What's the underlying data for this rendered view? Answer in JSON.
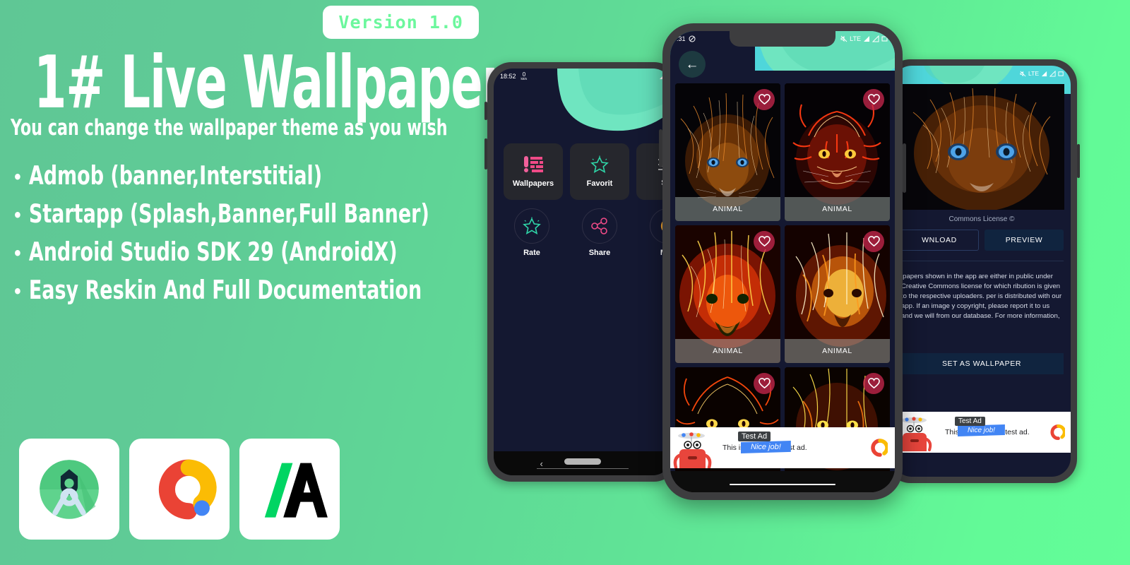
{
  "promo": {
    "title": "1# Live Wallpaper",
    "subtitle": "You can change the wallpaper theme as you wish",
    "bullet_char": "•",
    "features": [
      "Admob (banner,Interstitial)",
      "Startapp (Splash,Banner,Full Banner)",
      "Android Studio SDK 29 (AndroidX)",
      "Easy Reskin And Full Documentation"
    ],
    "version_badge": "Version 1.0",
    "tech_icons": [
      {
        "name": "android-studio-icon",
        "label": "Android Studio"
      },
      {
        "name": "admob-icon",
        "label": "AdMob"
      },
      {
        "name": "startapp-icon",
        "label": "StartApp"
      }
    ]
  },
  "colors": {
    "background_left": "#5fc795",
    "background_right": "#63fd98",
    "badge_text": "#6cf79d",
    "app_dark": "#141831",
    "accent_teal": "#6fe5c0",
    "favorite_pink": "#c4264c",
    "phone_frame": "#3d3d3f"
  },
  "phone_left": {
    "status": {
      "time": "18:52",
      "net_speed": "0",
      "net_unit": "kB/s"
    },
    "menu_tiles": [
      {
        "label": "Wallpapers",
        "icon": "wallpapers-icon"
      },
      {
        "label": "Favorit",
        "icon": "star-outline-icon"
      },
      {
        "label": "Se",
        "icon": "settings-sliders-icon"
      }
    ],
    "menu_circles": [
      {
        "label": "Rate",
        "icon": "star-outline-icon"
      },
      {
        "label": "Share",
        "icon": "share-icon"
      },
      {
        "label": "Mor",
        "icon": "more-icon"
      }
    ],
    "navbar": {
      "back": "‹"
    }
  },
  "phone_center": {
    "status": {
      "time": ":31",
      "lte": "LTE"
    },
    "back_arrow": "←",
    "wallpapers": [
      {
        "category": "ANIMAL",
        "subject": "lion",
        "favorited": true
      },
      {
        "category": "ANIMAL",
        "subject": "tiger",
        "favorited": true
      },
      {
        "category": "ANIMAL",
        "subject": "lion-fire",
        "favorited": true
      },
      {
        "category": "ANIMAL",
        "subject": "tiger-gold",
        "favorited": true
      },
      {
        "category": "",
        "subject": "tiger-neon",
        "favorited": true
      },
      {
        "category": "",
        "subject": "cheetah-neon",
        "favorited": true
      }
    ],
    "ad": {
      "tag": "Test Ad",
      "ribbon": "Nice job!",
      "text": "This is a 320x100 test ad."
    }
  },
  "phone_right": {
    "status": {
      "lte": "LTE"
    },
    "license": "Commons License ©",
    "buttons": {
      "download": "WNLOAD",
      "preview": "PREVIEW",
      "set_wallpaper": "SET AS WALLPAPER"
    },
    "disclaimer": "lpapers shown in the app are either in public under Creative Commons license for which ribution is given to the respective uploaders. per is distributed with our app. If an image y copyright, please report it to us and we will from our database. For more information,",
    "ad": {
      "tag": "Test Ad",
      "ribbon": "Nice job!",
      "text": "This is a 320x100 test ad."
    }
  }
}
